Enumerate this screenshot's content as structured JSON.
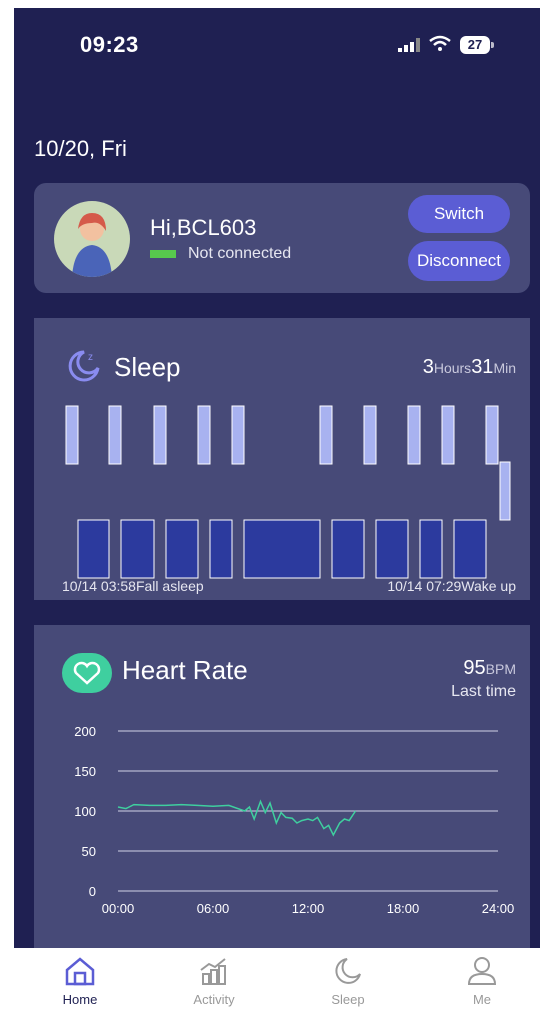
{
  "status": {
    "time": "09:23",
    "battery": "27"
  },
  "date": "10/20, Fri",
  "user": {
    "greeting": "Hi,BCL603",
    "status": "Not connected",
    "switch_label": "Switch",
    "disconnect_label": "Disconnect"
  },
  "sleep": {
    "title": "Sleep",
    "hours": "3",
    "hours_unit": "Hours",
    "minutes": "31",
    "minutes_unit": "Min",
    "start": "10/14 03:58Fall asleep",
    "end": "10/14 07:29Wake up"
  },
  "heart": {
    "title": "Heart Rate",
    "value": "95",
    "unit": "BPM",
    "note": "Last time",
    "chart_data": {
      "type": "line",
      "x": [
        0,
        0.5,
        1,
        2,
        3,
        4,
        5,
        6,
        7,
        8,
        8.3,
        8.6,
        9,
        9.3,
        9.6,
        10,
        10.3,
        10.6,
        11,
        11.3,
        11.6,
        12,
        12.3,
        12.6,
        13,
        13.3,
        13.6,
        14,
        14.3,
        14.6,
        15
      ],
      "series": [
        {
          "values": [
            105,
            103,
            108,
            107,
            107,
            108,
            107,
            106,
            107,
            100,
            105,
            90,
            112,
            98,
            110,
            85,
            98,
            92,
            91,
            85,
            88,
            90,
            88,
            92,
            78,
            82,
            70,
            85,
            90,
            88,
            100
          ]
        }
      ],
      "xticks": [
        "00:00",
        "06:00",
        "12:00",
        "18:00",
        "24:00"
      ],
      "yticks": [
        "0",
        "50",
        "100",
        "150",
        "200"
      ],
      "xlim": [
        0,
        24
      ],
      "ylim": [
        0,
        200
      ],
      "grid": true
    }
  },
  "tabs": [
    {
      "label": "Home",
      "icon": "home-icon"
    },
    {
      "label": "Activity",
      "icon": "activity-icon"
    },
    {
      "label": "Sleep",
      "icon": "moon-icon"
    },
    {
      "label": "Me",
      "icon": "person-icon"
    }
  ],
  "colors": {
    "bg": "#1f2052",
    "card": "#474a78",
    "accent": "#5b5dd4",
    "light_sleep": "#a8b2f0",
    "deep_sleep": "#2c3a9e",
    "heart": "#3fcf9f"
  }
}
